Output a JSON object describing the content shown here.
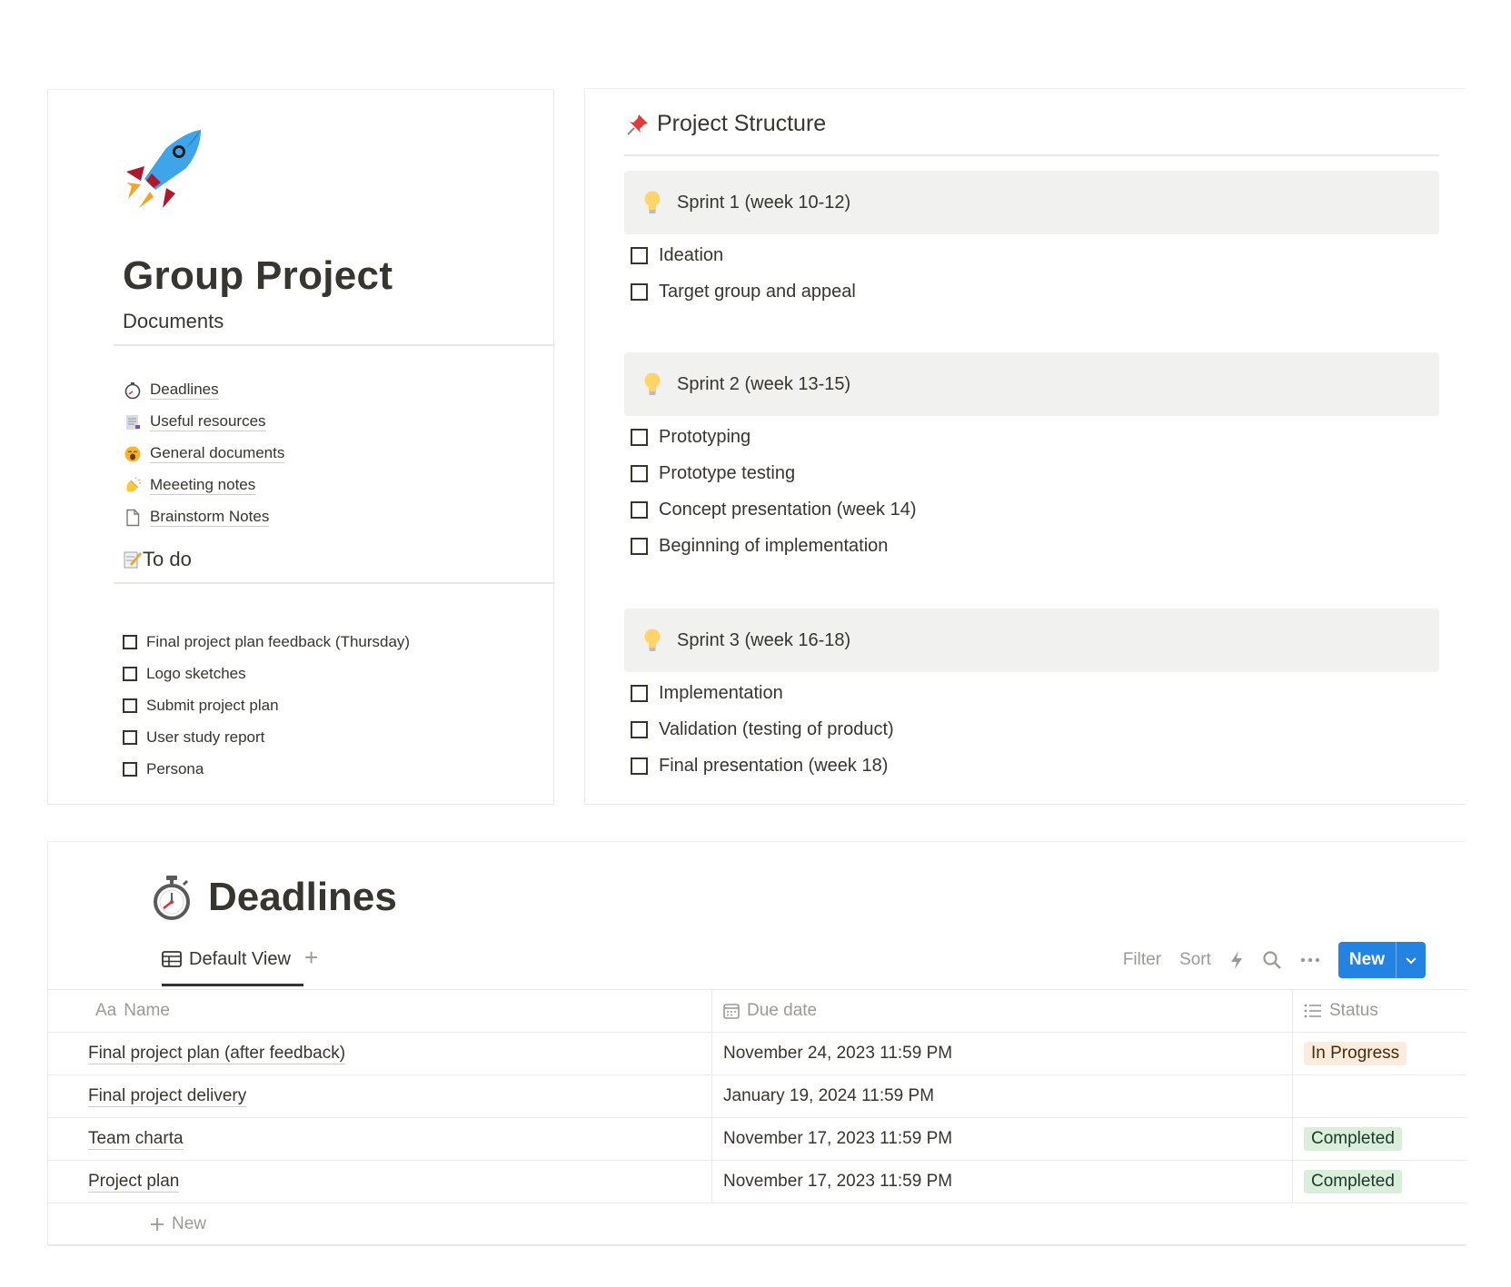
{
  "left": {
    "title": "Group Project",
    "documents_heading": "Documents",
    "documents": [
      {
        "label": "Deadlines",
        "icon": "stopwatch-icon"
      },
      {
        "label": "Useful resources",
        "icon": "bookmark-tabs-icon"
      },
      {
        "label": "General documents",
        "icon": "yawning-face-icon"
      },
      {
        "label": "Meeeting notes",
        "icon": "clapping-hands-icon"
      },
      {
        "label": "Brainstorm Notes",
        "icon": "page-icon"
      }
    ],
    "todo_heading": "To do",
    "todos": [
      {
        "label": "Final project plan feedback (Thursday)",
        "checked": false
      },
      {
        "label": "Logo sketches",
        "checked": false
      },
      {
        "label": "Submit project plan",
        "checked": false
      },
      {
        "label": "User study report",
        "checked": false
      },
      {
        "label": "Persona",
        "checked": false
      }
    ]
  },
  "right": {
    "heading": "Project Structure",
    "sprints": [
      {
        "title": "Sprint 1 (week 10-12)",
        "tasks": [
          "Ideation",
          "Target group and appeal"
        ]
      },
      {
        "title": "Sprint 2 (week 13-15)",
        "tasks": [
          "Prototyping",
          "Prototype testing",
          "Concept presentation (week 14)",
          "Beginning of implementation"
        ]
      },
      {
        "title": "Sprint 3 (week 16-18)",
        "tasks": [
          "Implementation",
          "Validation (testing of product)",
          "Final presentation (week 18)"
        ]
      }
    ]
  },
  "deadlines": {
    "title": "Deadlines",
    "view_label": "Default View",
    "toolbar": {
      "filter": "Filter",
      "sort": "Sort",
      "new": "New"
    },
    "columns": {
      "name": "Name",
      "name_prefix": "Aa",
      "due": "Due date",
      "status": "Status"
    },
    "rows": [
      {
        "name": "Final project plan (after feedback)",
        "due": "November 24, 2023 11:59 PM",
        "status": "In Progress"
      },
      {
        "name": "Final project delivery",
        "due": "January 19, 2024 11:59 PM",
        "status": ""
      },
      {
        "name": "Team charta",
        "due": "November 17, 2023 11:59 PM",
        "status": "Completed"
      },
      {
        "name": "Project plan",
        "due": "November 17, 2023 11:59 PM",
        "status": "Completed"
      }
    ],
    "new_row_label": "New",
    "colors": {
      "accent": "#2383e2",
      "in_progress_bg": "#fbecdd",
      "completed_bg": "#dbeddb"
    }
  }
}
